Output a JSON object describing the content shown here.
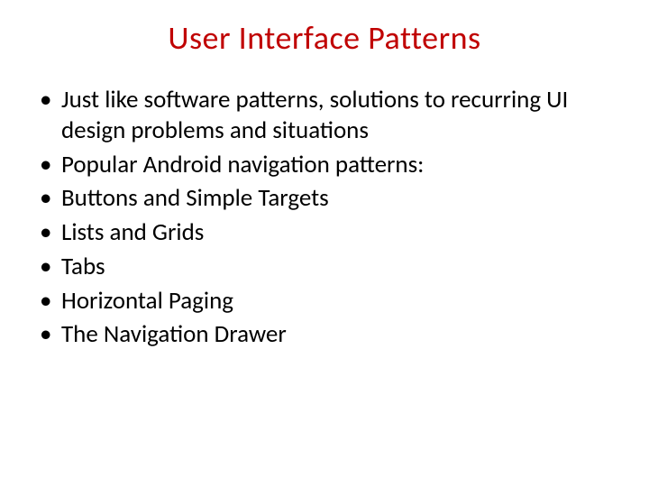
{
  "title": "User Interface Patterns",
  "bullets": [
    "Just like software patterns, solutions to recurring UI design problems and situations",
    "Popular Android navigation patterns:",
    "Buttons and Simple Targets",
    "Lists and Grids",
    "Tabs",
    "Horizontal Paging",
    "The Navigation Drawer"
  ]
}
